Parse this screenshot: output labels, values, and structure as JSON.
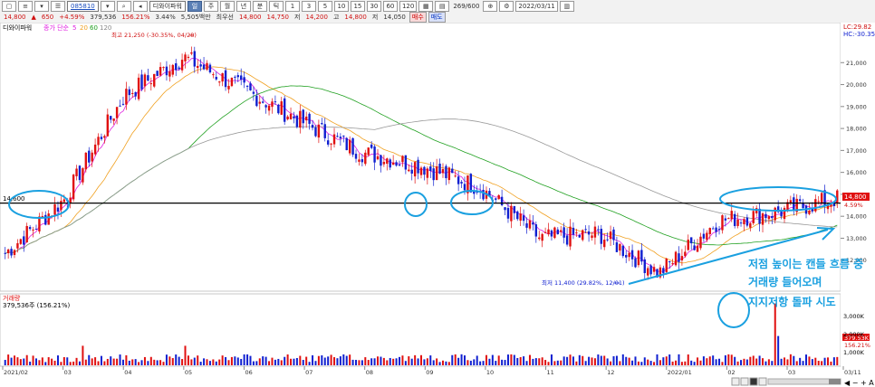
{
  "toolbar": {
    "stock_code": "085810",
    "stock_name": "디와이파워",
    "period_buttons": [
      "주",
      "월",
      "년",
      "분",
      "초",
      "틱"
    ],
    "interval_buttons": [
      "1",
      "3",
      "5",
      "10",
      "15",
      "30",
      "60",
      "120"
    ],
    "count": "269/600",
    "date": "2022/03/11",
    "buy_label": "매수",
    "sell_label": "매도",
    "quote": {
      "price": "14,800",
      "change": "650",
      "change_pct": "+4.59%",
      "volume": "379,536",
      "volume_pct": "156.21%",
      "turnover": "3.44%",
      "amount": "5,505백만",
      "bid_label": "최우선",
      "bid": "14,800",
      "ask": "14,750",
      "low_label": "저",
      "low": "14,200",
      "high_label": "고",
      "high": "14,800",
      "base_label": "저",
      "base": "14,050"
    }
  },
  "chart_data": {
    "type": "candlestick",
    "legend": {
      "name": "디와이파워",
      "ma_label": "종가 단순",
      "ma_periods": [
        {
          "period": "5",
          "color": "#e020e0"
        },
        {
          "period": "20",
          "color": "#f0a020"
        },
        {
          "period": "60",
          "color": "#20a020"
        },
        {
          "period": "120",
          "color": "#999999"
        }
      ]
    },
    "y_axis": {
      "ticks": [
        "21,000",
        "20,000",
        "19,000",
        "18,000",
        "17,000",
        "16,000",
        "15,000",
        "14,000",
        "13,000",
        "12,000"
      ],
      "ylim": [
        11000,
        22000
      ]
    },
    "x_axis": {
      "labels": [
        "2021/02",
        "03",
        "04",
        "05",
        "06",
        "07",
        "08",
        "09",
        "10",
        "11",
        "12",
        "2022/01",
        "02",
        "03",
        "03/11"
      ]
    },
    "top_right_labels": [
      "LC:29.82",
      "HC:-30.35"
    ],
    "current_price_tag": "14,800",
    "current_change_tag": "4.59%",
    "support_line": {
      "price": 14600,
      "label": "14,600"
    },
    "annotations": {
      "high": "최고 21,250 (-30.35%, 04/28)",
      "low": "최저 11,400 (29.82%, 12/01)"
    },
    "overlay_text": [
      "저점 높이는 캔들 흐름 중",
      "거래량 들어오며",
      "지지저항 돌파 시도"
    ],
    "volume_panel": {
      "legend": "거래량",
      "current": "379,536주 (156.21%)",
      "ticks": [
        "3,000K",
        "2,000K",
        "1,000K"
      ],
      "current_tag": "379.53K",
      "current_pct_tag": "156.21%"
    },
    "series_summary": [
      {
        "period": "2021/02",
        "price": 12300
      },
      {
        "period": "03",
        "price": 14800
      },
      {
        "period": "04",
        "price": 19500
      },
      {
        "period": "04/28",
        "price": 21250
      },
      {
        "period": "05",
        "price": 19800
      },
      {
        "period": "06",
        "price": 18300
      },
      {
        "period": "07",
        "price": 16900
      },
      {
        "period": "08",
        "price": 16300
      },
      {
        "period": "09",
        "price": 15300
      },
      {
        "period": "10",
        "price": 13000
      },
      {
        "period": "11",
        "price": 13200
      },
      {
        "period": "12/01",
        "price": 11400
      },
      {
        "period": "2022/01",
        "price": 13800
      },
      {
        "period": "02",
        "price": 14200
      },
      {
        "period": "03/11",
        "price": 14800
      }
    ]
  },
  "colors": {
    "up": "#e01010",
    "down": "#1020d0",
    "annotation": "#1aa0e0",
    "support": "#000000"
  }
}
